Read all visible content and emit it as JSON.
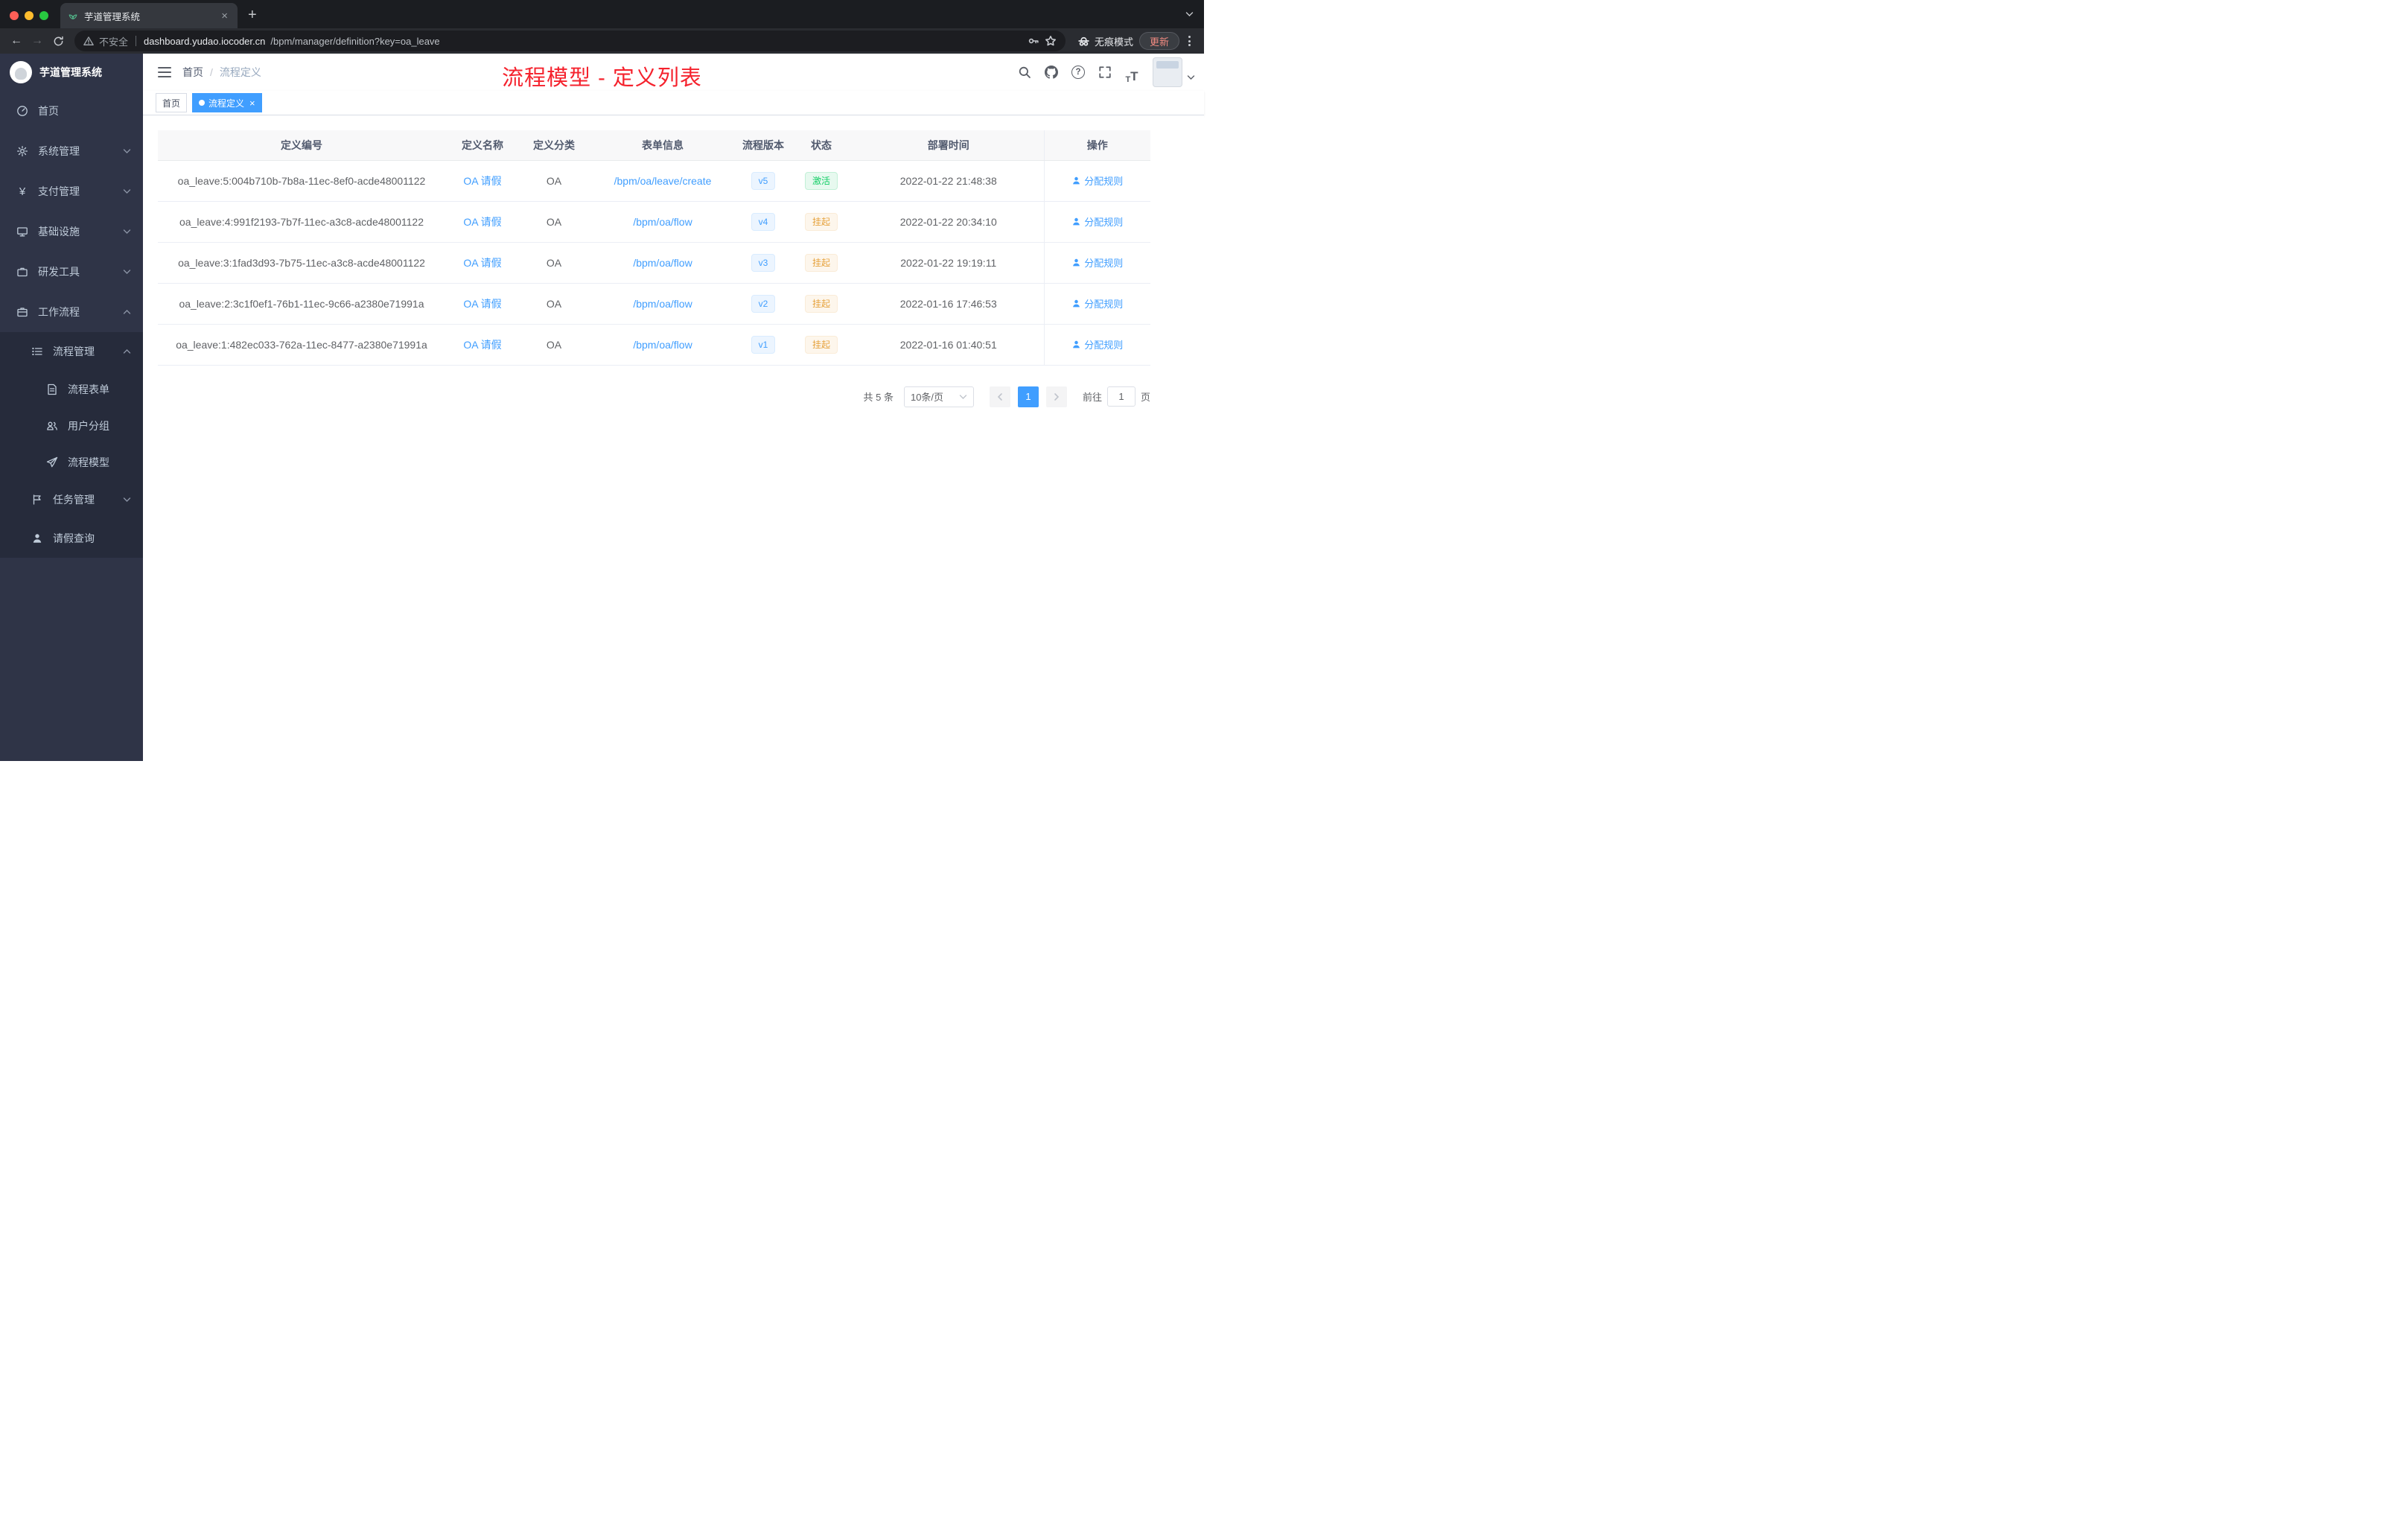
{
  "colors": {
    "accent_blue": "#409eff",
    "banner_red": "#f5222d",
    "success_green": "#13ce66",
    "warning_orange": "#e6a23c",
    "sidebar_bg": "#2f3447",
    "submenu_bg": "#262b3b"
  },
  "browser": {
    "tab_title": "芋道管理系统",
    "security_label": "不安全",
    "url_host": "dashboard.yudao.iocoder.cn",
    "url_path": "/bpm/manager/definition?key=oa_leave",
    "incognito_label": "无痕模式",
    "update_label": "更新"
  },
  "glyphs": {
    "close": "×",
    "plus": "+",
    "back": "←",
    "forward": "→",
    "question": "?",
    "font_size": "T",
    "yen": "¥"
  },
  "sidebar": {
    "app_title": "芋道管理系统",
    "menu": [
      {
        "label": "首页"
      },
      {
        "label": "系统管理"
      },
      {
        "label": "支付管理"
      },
      {
        "label": "基础设施"
      },
      {
        "label": "研发工具"
      },
      {
        "label": "工作流程"
      }
    ],
    "submenu": {
      "label": "流程管理",
      "children": [
        {
          "label": "流程表单"
        },
        {
          "label": "用户分组"
        },
        {
          "label": "流程模型"
        }
      ]
    },
    "task": {
      "label": "任务管理"
    },
    "leave": {
      "label": "请假查询"
    }
  },
  "header": {
    "breadcrumb": {
      "home": "首页",
      "separator": "/",
      "current": "流程定义"
    },
    "banner": "流程模型 - 定义列表"
  },
  "tags": {
    "home": "首页",
    "active": "流程定义"
  },
  "table": {
    "columns": [
      "定义编号",
      "定义名称",
      "定义分类",
      "表单信息",
      "流程版本",
      "状态",
      "部署时间",
      "操作"
    ],
    "action_label": "分配规则",
    "rows": [
      {
        "id": "oa_leave:5:004b710b-7b8a-11ec-8ef0-acde48001122",
        "name": "OA 请假",
        "category": "OA",
        "form": "/bpm/oa/leave/create",
        "version": "v5",
        "status": "激活",
        "status_type": "success",
        "time": "2022-01-22 21:48:38"
      },
      {
        "id": "oa_leave:4:991f2193-7b7f-11ec-a3c8-acde48001122",
        "name": "OA 请假",
        "category": "OA",
        "form": "/bpm/oa/flow",
        "version": "v4",
        "status": "挂起",
        "status_type": "warning",
        "time": "2022-01-22 20:34:10"
      },
      {
        "id": "oa_leave:3:1fad3d93-7b75-11ec-a3c8-acde48001122",
        "name": "OA 请假",
        "category": "OA",
        "form": "/bpm/oa/flow",
        "version": "v3",
        "status": "挂起",
        "status_type": "warning",
        "time": "2022-01-22 19:19:11"
      },
      {
        "id": "oa_leave:2:3c1f0ef1-76b1-11ec-9c66-a2380e71991a",
        "name": "OA 请假",
        "category": "OA",
        "form": "/bpm/oa/flow",
        "version": "v2",
        "status": "挂起",
        "status_type": "warning",
        "time": "2022-01-16 17:46:53"
      },
      {
        "id": "oa_leave:1:482ec033-762a-11ec-8477-a2380e71991a",
        "name": "OA 请假",
        "category": "OA",
        "form": "/bpm/oa/flow",
        "version": "v1",
        "status": "挂起",
        "status_type": "warning",
        "time": "2022-01-16 01:40:51"
      }
    ]
  },
  "pagination": {
    "total": "共 5 条",
    "page_size": "10条/页",
    "page": "1",
    "goto_label": "前往",
    "goto_value": "1",
    "unit_label": "页"
  }
}
